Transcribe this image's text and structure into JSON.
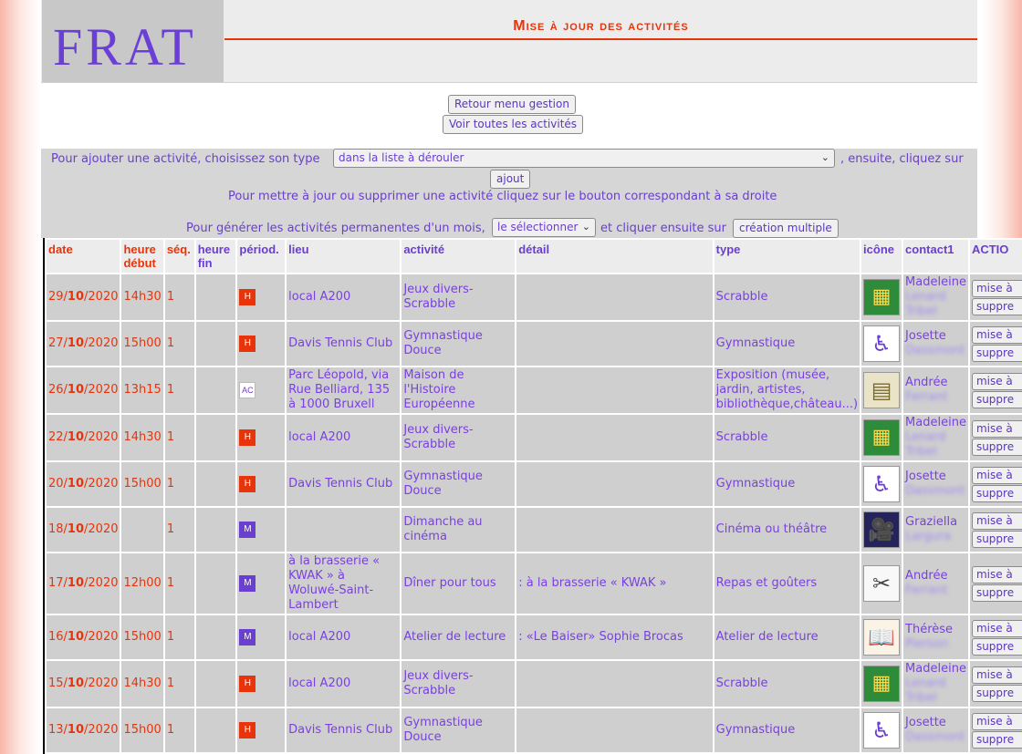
{
  "header": {
    "logo": "FRAT",
    "title": "Mise à jour des activités"
  },
  "buttons": {
    "back": "Retour menu gestion",
    "all": "Voir toutes les activités"
  },
  "controls": {
    "line1_before": "Pour ajouter une activité, choisissez son type",
    "type_select": "dans la liste à dérouler",
    "line1_after": ", ensuite, cliquez sur",
    "add_button": "ajout",
    "line2": "Pour mettre à jour ou supprimer une activité cliquez sur le bouton correspondant à sa droite",
    "line3_before": "Pour générer les activités permanentes d'un mois,",
    "month_select": "le sélectionner",
    "line3_after": "et cliquer ensuite sur",
    "multi_button": "création multiple"
  },
  "table": {
    "headers": {
      "date": "date",
      "start": "heure début",
      "seq": "séq.",
      "end": "heure fin",
      "period": "périod.",
      "place": "lieu",
      "activity": "activité",
      "detail": "détail",
      "type": "type",
      "icon": "icône",
      "contact": "contact1",
      "actions": "ACTIO"
    },
    "update_label": "mise à",
    "delete_label": "suppre",
    "rows": [
      {
        "d": "29/",
        "m": "10",
        "y": "/2020",
        "start": "14h30",
        "seq": "1",
        "end": "",
        "period": "H",
        "place": "local A200",
        "activity": "Jeux divers-Scrabble",
        "detail": "",
        "type": "Scrabble",
        "icon": "scrabble-icon",
        "glyph": "▦",
        "contact": "Madeleine",
        "contact_blur": "Lenard Tribel"
      },
      {
        "d": "27/",
        "m": "10",
        "y": "/2020",
        "start": "15h00",
        "seq": "1",
        "end": "",
        "period": "H",
        "place": "Davis Tennis Club",
        "activity": "Gymnastique Douce",
        "detail": "",
        "type": "Gymnastique",
        "icon": "gymnastics-icon",
        "glyph": "♿",
        "contact": "Josette",
        "contact_blur": "Dassmont"
      },
      {
        "d": "26/",
        "m": "10",
        "y": "/2020",
        "start": "13h15",
        "seq": "1",
        "end": "",
        "period": "AC",
        "place": "Parc Léopold, via Rue Belliard, 135 à 1000 Bruxell",
        "activity": "Maison de l'Histoire Européenne",
        "detail": "",
        "type": "Exposition (musée, jardin, artistes, bibliothèque,château...)",
        "icon": "exhibition-icon",
        "glyph": "▤",
        "contact": "Andrée",
        "contact_blur": "Ferrant"
      },
      {
        "d": "22/",
        "m": "10",
        "y": "/2020",
        "start": "14h30",
        "seq": "1",
        "end": "",
        "period": "H",
        "place": "local A200",
        "activity": "Jeux divers-Scrabble",
        "detail": "",
        "type": "Scrabble",
        "icon": "scrabble-icon",
        "glyph": "▦",
        "contact": "Madeleine",
        "contact_blur": "Lenard Tribel"
      },
      {
        "d": "20/",
        "m": "10",
        "y": "/2020",
        "start": "15h00",
        "seq": "1",
        "end": "",
        "period": "H",
        "place": "Davis Tennis Club",
        "activity": "Gymnastique Douce",
        "detail": "",
        "type": "Gymnastique",
        "icon": "gymnastics-icon",
        "glyph": "♿",
        "contact": "Josette",
        "contact_blur": "Dassmont"
      },
      {
        "d": "18/",
        "m": "10",
        "y": "/2020",
        "start": "",
        "seq": "1",
        "end": "",
        "period": "M",
        "place": "",
        "activity": "Dimanche au cinéma",
        "detail": "",
        "type": "Cinéma ou théâtre",
        "icon": "cinema-icon",
        "glyph": "🎥",
        "contact": "Graziella",
        "contact_blur": "Largura"
      },
      {
        "d": "17/",
        "m": "10",
        "y": "/2020",
        "start": "12h00",
        "seq": "1",
        "end": "",
        "period": "M",
        "place": "à la brasserie « KWAK » à Woluwé-Saint-Lambert",
        "activity": "Dîner pour tous",
        "detail": ": à la brasserie « KWAK »",
        "type": "Repas et goûters",
        "icon": "meal-icon",
        "glyph": "✂",
        "contact": "Andrée",
        "contact_blur": "Ferrant"
      },
      {
        "d": "16/",
        "m": "10",
        "y": "/2020",
        "start": "15h00",
        "seq": "1",
        "end": "",
        "period": "M",
        "place": "local A200",
        "activity": "Atelier de lecture",
        "detail": ": «Le Baiser» Sophie Brocas",
        "type": "Atelier de lecture",
        "icon": "book-icon",
        "glyph": "📖",
        "contact": "Thérèse",
        "contact_blur": "Pierson"
      },
      {
        "d": "15/",
        "m": "10",
        "y": "/2020",
        "start": "14h30",
        "seq": "1",
        "end": "",
        "period": "H",
        "place": "local A200",
        "activity": "Jeux divers-Scrabble",
        "detail": "",
        "type": "Scrabble",
        "icon": "scrabble-icon",
        "glyph": "▦",
        "contact": "Madeleine",
        "contact_blur": "Lenard Tribel"
      },
      {
        "d": "13/",
        "m": "10",
        "y": "/2020",
        "start": "15h00",
        "seq": "1",
        "end": "",
        "period": "H",
        "place": "Davis Tennis Club",
        "activity": "Gymnastique Douce",
        "detail": "",
        "type": "Gymnastique",
        "icon": "gymnastics-icon",
        "glyph": "♿",
        "contact": "Josette",
        "contact_blur": "Dassmont"
      }
    ]
  }
}
